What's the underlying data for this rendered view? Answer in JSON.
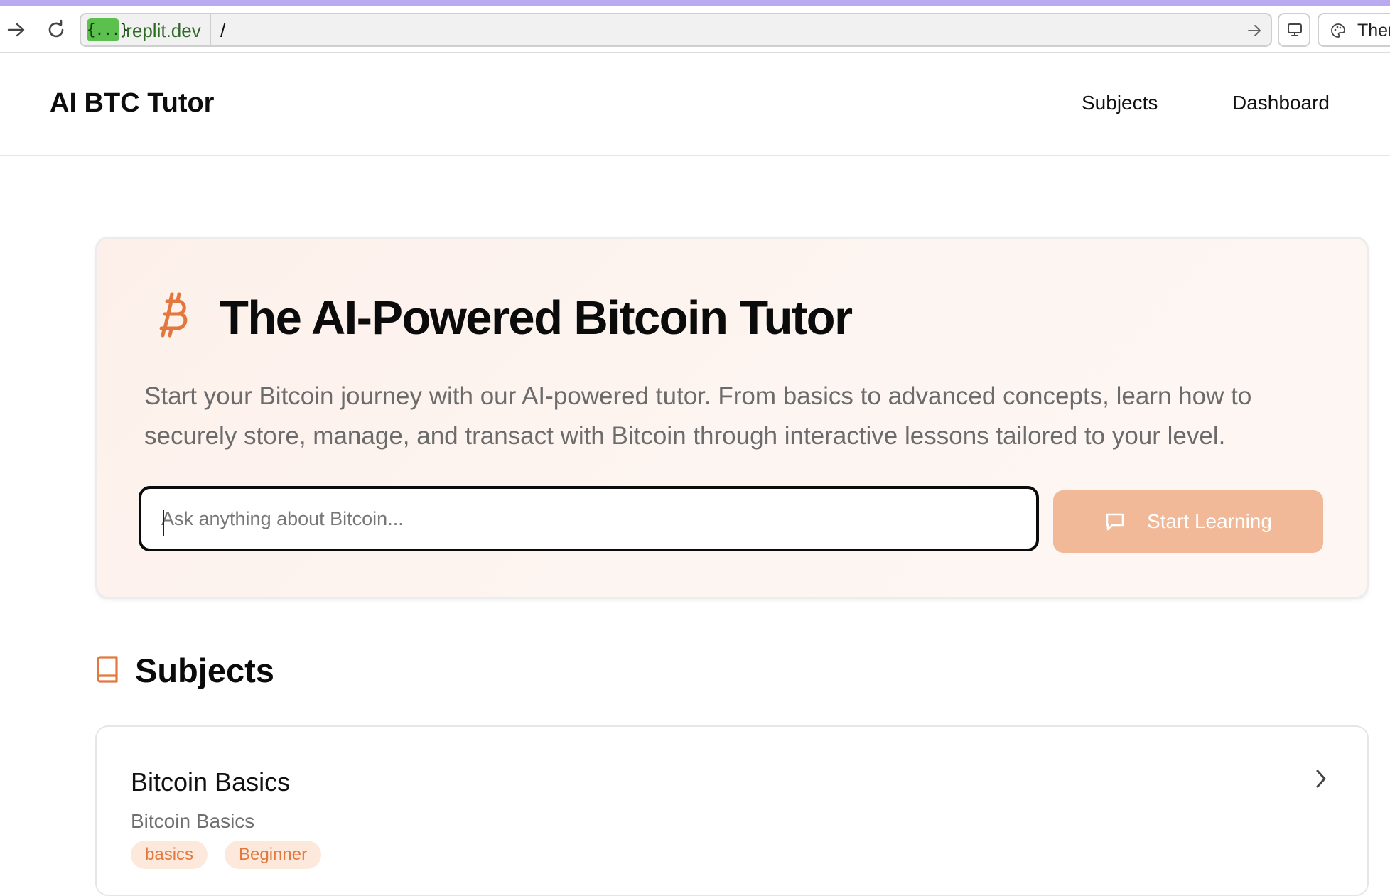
{
  "browser": {
    "domain_badge": "{...}",
    "domain": ".replit.dev",
    "path": "/",
    "theme_label": "Ther"
  },
  "header": {
    "logo": "AI BTC Tutor",
    "nav": [
      "Subjects",
      "Dashboard"
    ]
  },
  "hero": {
    "title": "The AI-Powered Bitcoin Tutor",
    "description": "Start your Bitcoin journey with our AI-powered tutor. From basics to advanced concepts, learn how to securely store, manage, and transact with Bitcoin through interactive lessons tailored to your level.",
    "input_placeholder": "Ask anything about Bitcoin...",
    "input_value": "",
    "button_label": "Start Learning"
  },
  "subjects": {
    "heading": "Subjects",
    "items": [
      {
        "title": "Bitcoin Basics",
        "subtitle": "Bitcoin Basics",
        "tags": [
          "basics",
          "Beginner"
        ]
      }
    ]
  },
  "colors": {
    "accent": "#e2783e",
    "button_bg": "#f1b998",
    "hero_bg": "#fdf0ea",
    "browser_accent": "#b9aaf2"
  },
  "icons": [
    "forward-arrow-icon",
    "reload-icon",
    "go-arrow-icon",
    "device-icon",
    "palette-icon",
    "bitcoin-icon",
    "chat-icon",
    "book-icon",
    "chevron-right-icon"
  ]
}
